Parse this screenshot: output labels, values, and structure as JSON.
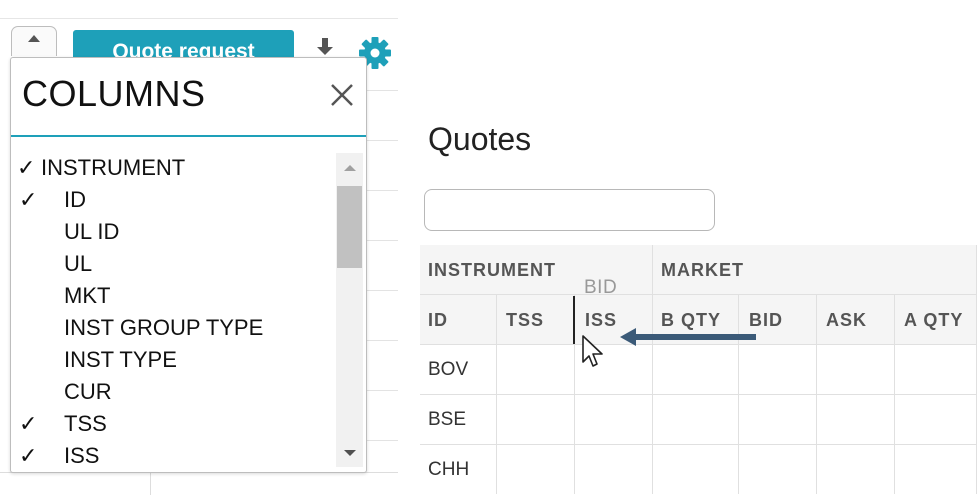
{
  "toolbar": {
    "quote_request_label": "Quote request",
    "icons": [
      "download-icon",
      "gear-icon"
    ],
    "accent_color": "#1ea0b9"
  },
  "columns_popup": {
    "title": "COLUMNS",
    "close_symbol": "×",
    "items": [
      {
        "label": "INSTRUMENT",
        "checked": true,
        "group": true
      },
      {
        "label": "ID",
        "checked": true,
        "group": false
      },
      {
        "label": "UL ID",
        "checked": false,
        "group": false
      },
      {
        "label": "UL",
        "checked": false,
        "group": false
      },
      {
        "label": "MKT",
        "checked": false,
        "group": false
      },
      {
        "label": "INST GROUP TYPE",
        "checked": false,
        "group": false
      },
      {
        "label": "INST TYPE",
        "checked": false,
        "group": false
      },
      {
        "label": "CUR",
        "checked": false,
        "group": false
      },
      {
        "label": "TSS",
        "checked": true,
        "group": false
      },
      {
        "label": "ISS",
        "checked": true,
        "group": false
      }
    ]
  },
  "quotes": {
    "title": "Quotes",
    "search_value": "",
    "group_headers": [
      "INSTRUMENT",
      "MARKET"
    ],
    "columns": [
      "ID",
      "TSS",
      "ISS",
      "B QTY",
      "BID",
      "ASK",
      "A QTY"
    ],
    "rows": [
      [
        "BOV",
        "",
        "",
        "",
        "",
        "",
        ""
      ],
      [
        "BSE",
        "",
        "",
        "",
        "",
        "",
        ""
      ],
      [
        "CHH",
        "",
        "",
        "",
        "",
        "",
        ""
      ]
    ],
    "drag_ghost_label": "BID"
  }
}
